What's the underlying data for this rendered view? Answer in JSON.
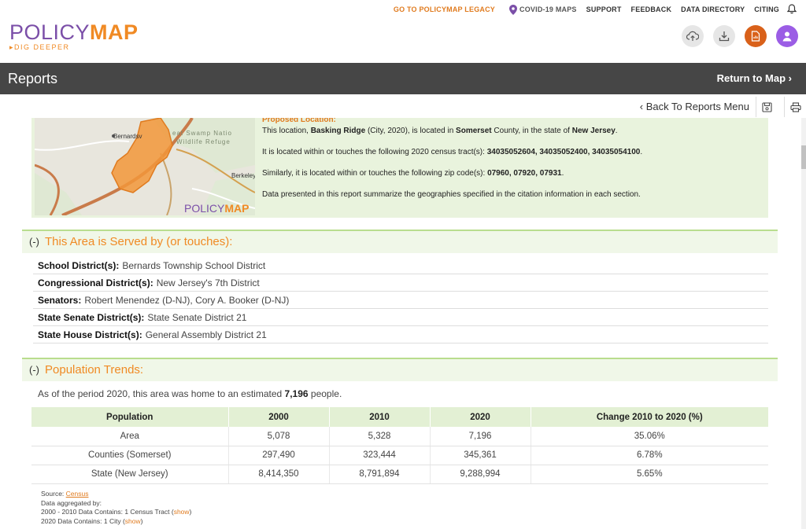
{
  "brand": {
    "logo_left": "POLICY",
    "logo_right": "MAP",
    "tagline": "DIG DEEPER"
  },
  "nav": {
    "legacy": "GO TO POLICYMAP LEGACY",
    "covid": "COVID-19 MAPS",
    "support": "SUPPORT",
    "feedback": "FEEDBACK",
    "directory": "DATA DIRECTORY",
    "citing": "CITING"
  },
  "reports_bar": {
    "title": "Reports",
    "return": "Return to Map ›"
  },
  "subbar": {
    "back": "‹ Back To Reports Menu"
  },
  "map": {
    "label_bernards": "Bernardsv",
    "label_swamp1": "eat Swamp Natio",
    "label_swamp2": "Wildlife Refuge",
    "label_berkeley": "Berkeley",
    "watermark_left": "POLICY",
    "watermark_right": "MAP"
  },
  "location": {
    "heading": "Proposed Location:",
    "p1_pre": "This location,",
    "p1_place": "Basking Ridge",
    "p1_mid": "(City, 2020), is located in",
    "p1_county": "Somerset",
    "p1_mid2": "County, in the state of",
    "p1_state": "New Jersey",
    "p1_end": ".",
    "p2_pre": "It is located within or touches the following 2020 census tract(s):",
    "p2_tracts": "34035052604, 34035052400, 34035054100",
    "p2_end": ".",
    "p3_pre": "Similarly, it is located within or touches the following zip code(s):",
    "p3_zips": "07960, 07920, 07931",
    "p3_end": ".",
    "p4": "Data presented in this report summarize the geographies specified in the citation information in each section."
  },
  "served": {
    "toggle": "(-)",
    "title": "This Area is Served by (or touches):",
    "rows": [
      {
        "key": "School District(s):",
        "value": "Bernards Township School District"
      },
      {
        "key": "Congressional District(s):",
        "value": "New Jersey's 7th District"
      },
      {
        "key": "Senators:",
        "value": "Robert Menendez (D-NJ), Cory A. Booker (D-NJ)"
      },
      {
        "key": "State Senate District(s):",
        "value": "State Senate District 21"
      },
      {
        "key": "State House District(s):",
        "value": "General Assembly District 21"
      }
    ]
  },
  "population": {
    "toggle": "(-)",
    "title": "Population Trends:",
    "intro_pre": "As of the period 2020, this area was home to an estimated",
    "intro_value": "7,196",
    "intro_end": "people.",
    "columns": [
      "Population",
      "2000",
      "2010",
      "2020",
      "Change 2010 to 2020 (%)"
    ],
    "rows": [
      [
        "Area",
        "5,078",
        "5,328",
        "7,196",
        "35.06%"
      ],
      [
        "Counties (Somerset)",
        "297,490",
        "323,444",
        "345,361",
        "6.78%"
      ],
      [
        "State (New Jersey)",
        "8,414,350",
        "8,791,894",
        "9,288,994",
        "5.65%"
      ]
    ],
    "source_label": "Source:",
    "source_link": "Census",
    "agg": "Data aggregated by:",
    "line1_pre": "2000 - 2010 Data Contains: 1 Census Tract (",
    "line1_link": "show",
    "line1_end": ")",
    "line2_pre": "2020 Data Contains: 1 City (",
    "line2_link": "show",
    "line2_end": ")"
  }
}
